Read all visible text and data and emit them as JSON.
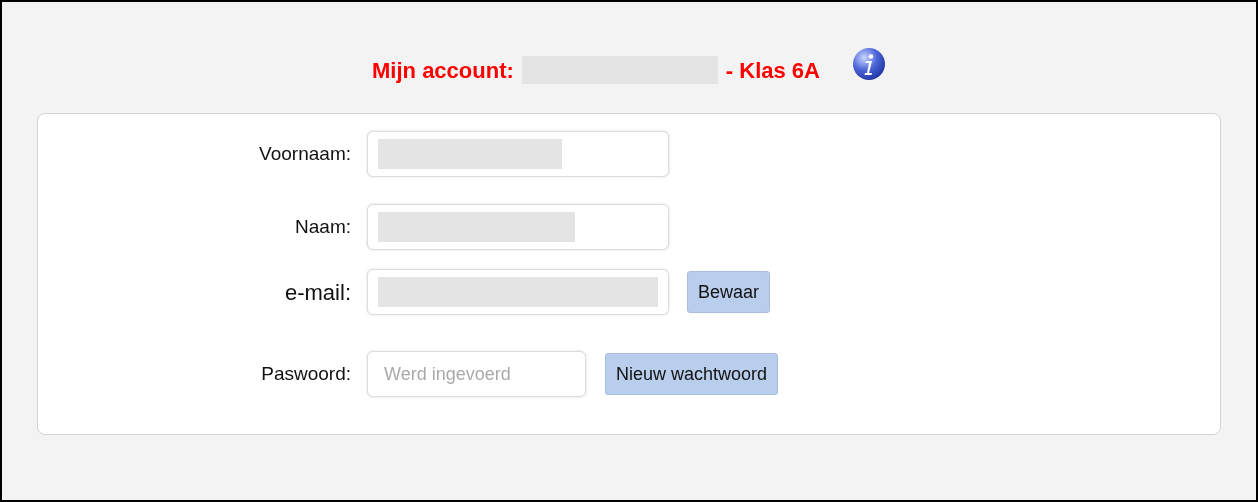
{
  "title": {
    "label": "Mijn account:",
    "class_name": "- Klas 6A"
  },
  "form": {
    "fields": [
      {
        "label": "Voornaam:",
        "kind": "redacted"
      },
      {
        "label": "Naam:",
        "kind": "redacted"
      },
      {
        "label": "e-mail:",
        "kind": "redacted",
        "button": "Bewaar"
      },
      {
        "label": "Paswoord:",
        "kind": "password",
        "placeholder": "Werd ingevoerd",
        "button": "Nieuw wachtwoord"
      }
    ]
  }
}
